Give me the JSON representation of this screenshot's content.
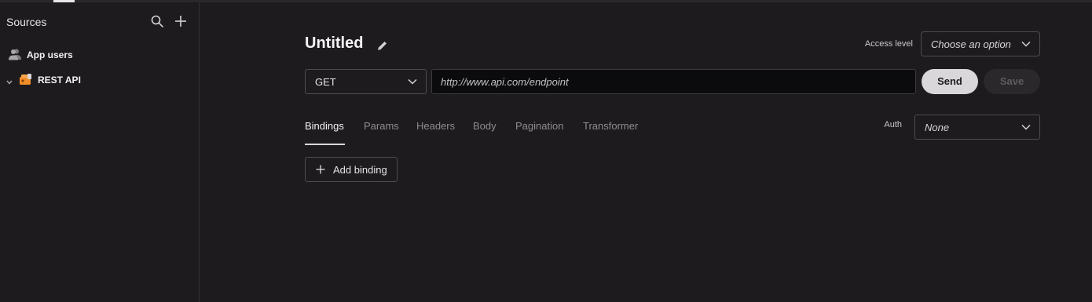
{
  "sidebar": {
    "title": "Sources",
    "items": [
      {
        "label": "App users",
        "icon": "user-group-icon"
      },
      {
        "label": "REST API",
        "icon": "rest-api-icon",
        "expanded": false
      }
    ]
  },
  "main": {
    "title": "Untitled",
    "access_level": {
      "label": "Access level",
      "value": "Choose an option"
    },
    "method": {
      "value": "GET"
    },
    "url": {
      "placeholder": "http://www.api.com/endpoint",
      "value": ""
    },
    "send_label": "Send",
    "save_label": "Save",
    "tabs": [
      {
        "label": "Bindings",
        "active": true
      },
      {
        "label": "Params"
      },
      {
        "label": "Headers"
      },
      {
        "label": "Body"
      },
      {
        "label": "Pagination"
      },
      {
        "label": "Transformer"
      }
    ],
    "auth": {
      "label": "Auth",
      "value": "None"
    },
    "add_binding_label": "Add binding"
  },
  "colors": {
    "background": "#1d1b1e",
    "send_button": "#d9d7da",
    "rest_api_icon": "#f28c28"
  }
}
